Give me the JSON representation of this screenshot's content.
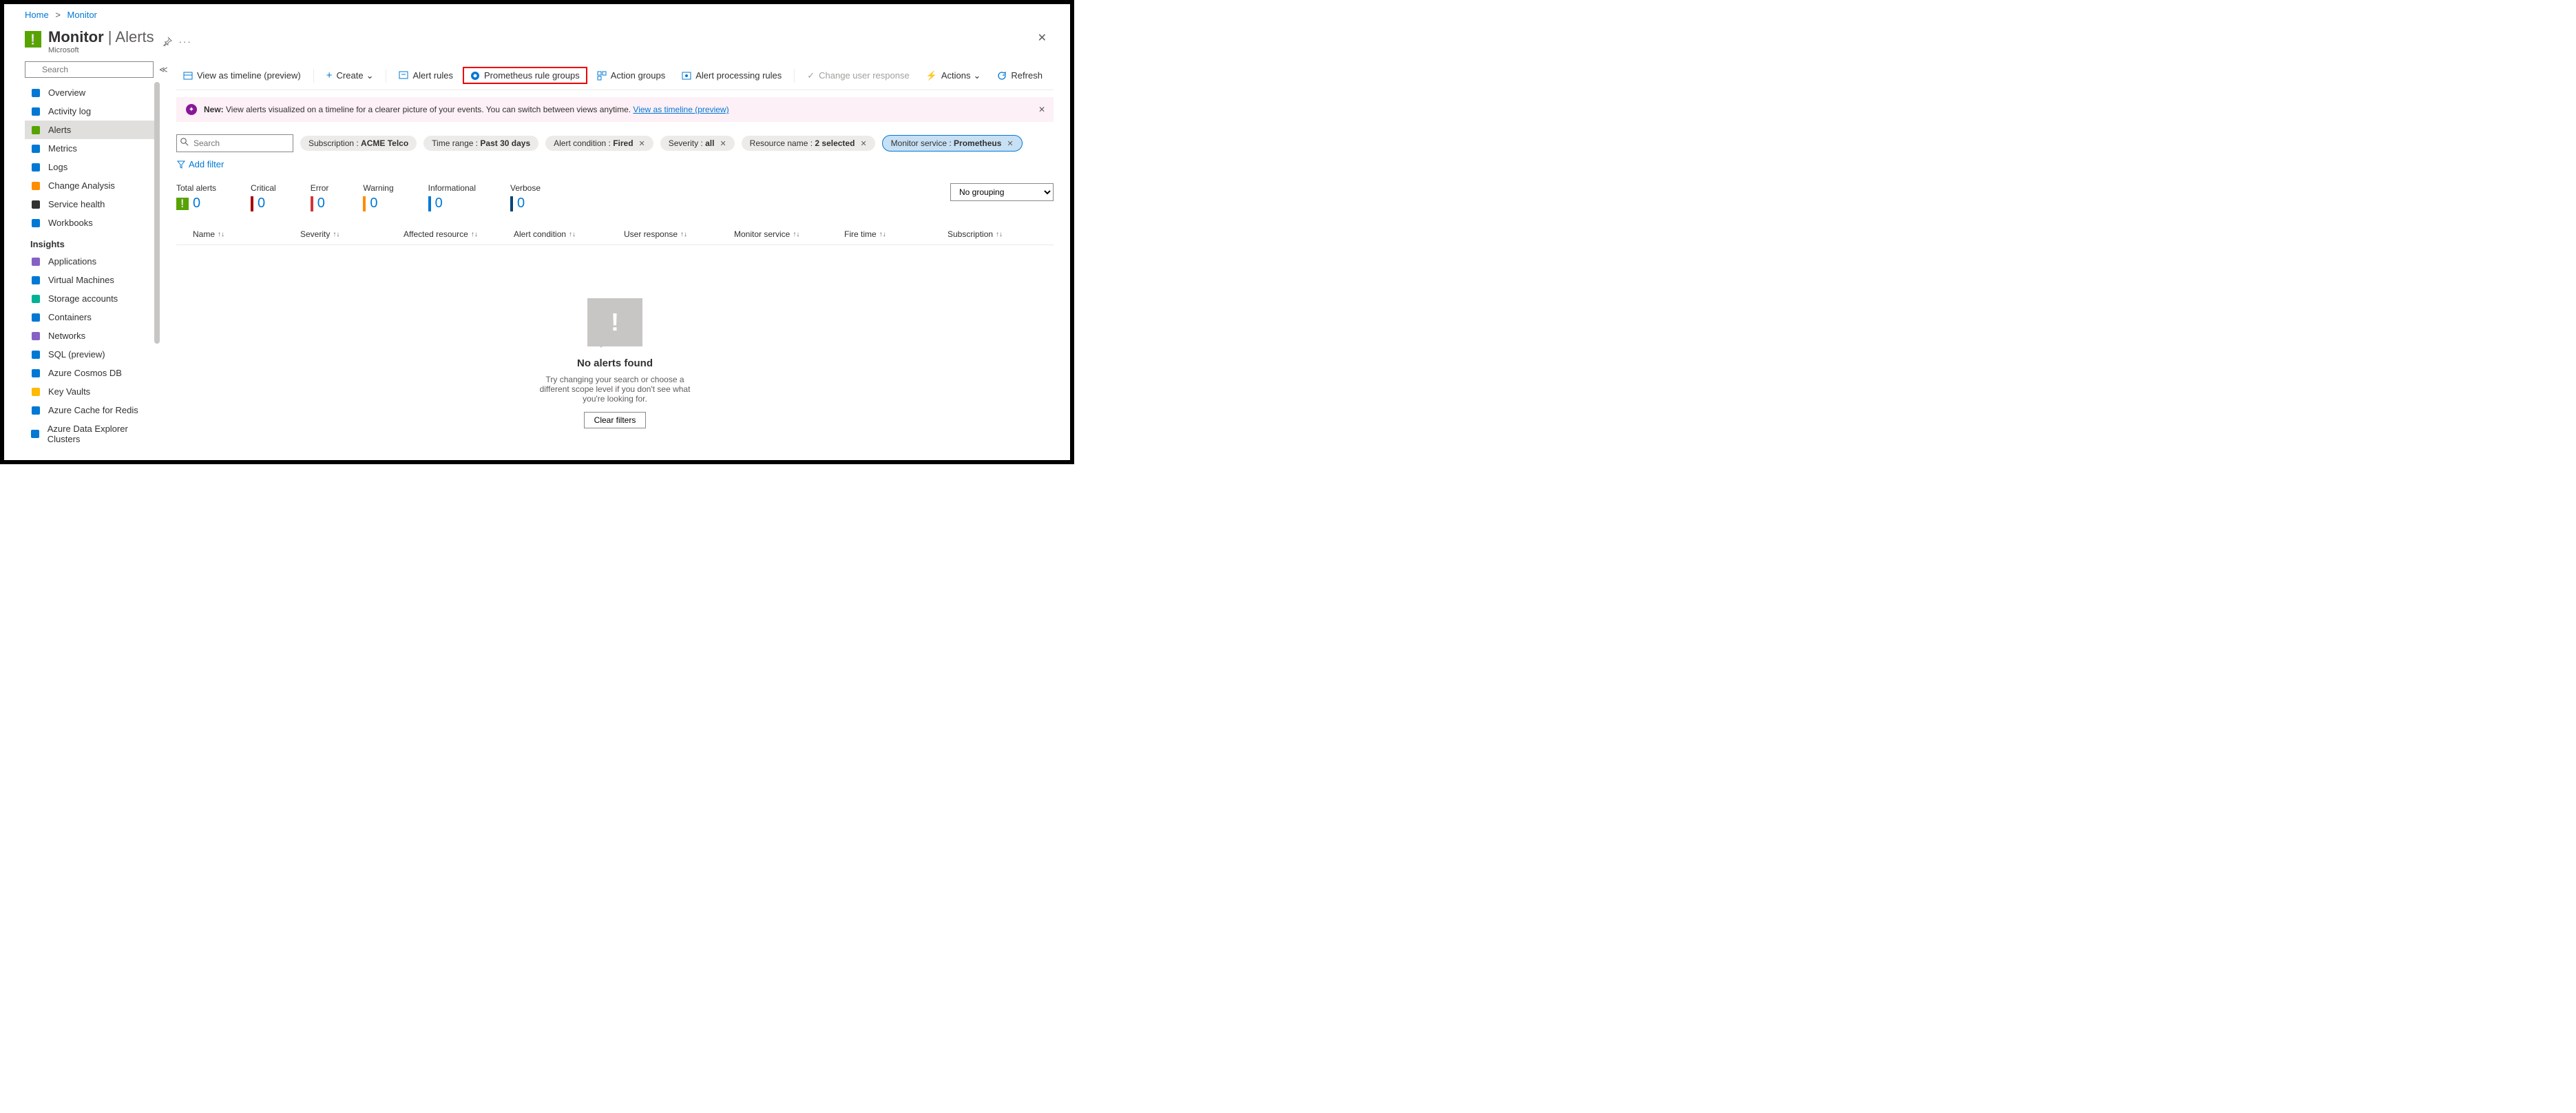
{
  "breadcrumb": {
    "home": "Home",
    "monitor": "Monitor"
  },
  "header": {
    "title_main": "Monitor",
    "title_sub": "Alerts",
    "vendor": "Microsoft"
  },
  "sidebar": {
    "search_placeholder": "Search",
    "items": [
      {
        "label": "Overview",
        "icon": "gauge",
        "color": "#0078d4"
      },
      {
        "label": "Activity log",
        "icon": "log",
        "color": "#0078d4"
      },
      {
        "label": "Alerts",
        "icon": "alert",
        "color": "#57a300",
        "active": true
      },
      {
        "label": "Metrics",
        "icon": "chart",
        "color": "#0078d4"
      },
      {
        "label": "Logs",
        "icon": "logs",
        "color": "#0078d4"
      },
      {
        "label": "Change Analysis",
        "icon": "change",
        "color": "#ff8c00"
      },
      {
        "label": "Service health",
        "icon": "heart",
        "color": "#323130"
      },
      {
        "label": "Workbooks",
        "icon": "book",
        "color": "#0078d4"
      }
    ],
    "section_insights": "Insights",
    "insights": [
      {
        "label": "Applications",
        "icon": "app",
        "color": "#8661c5"
      },
      {
        "label": "Virtual Machines",
        "icon": "vm",
        "color": "#0078d4"
      },
      {
        "label": "Storage accounts",
        "icon": "storage",
        "color": "#00b294"
      },
      {
        "label": "Containers",
        "icon": "container",
        "color": "#0078d4"
      },
      {
        "label": "Networks",
        "icon": "network",
        "color": "#8661c5"
      },
      {
        "label": "SQL (preview)",
        "icon": "sql",
        "color": "#0078d4"
      },
      {
        "label": "Azure Cosmos DB",
        "icon": "cosmos",
        "color": "#0078d4"
      },
      {
        "label": "Key Vaults",
        "icon": "key",
        "color": "#ffb900"
      },
      {
        "label": "Azure Cache for Redis",
        "icon": "redis",
        "color": "#0078d4"
      },
      {
        "label": "Azure Data Explorer Clusters",
        "icon": "adx",
        "color": "#0078d4"
      }
    ]
  },
  "toolbar": {
    "timeline": "View as timeline (preview)",
    "create": "Create",
    "alert_rules": "Alert rules",
    "prometheus": "Prometheus rule groups",
    "action_groups": "Action groups",
    "processing": "Alert processing rules",
    "change_user": "Change user response",
    "actions": "Actions",
    "refresh": "Refresh"
  },
  "banner": {
    "bold": "New:",
    "text": " View alerts visualized on a timeline for a clearer picture of your events. You can switch between views anytime. ",
    "link": "View as timeline (preview)"
  },
  "filters": {
    "search_placeholder": "Search",
    "chips": [
      {
        "label": "Subscription : ",
        "value": "ACME Telco",
        "x": false
      },
      {
        "label": "Time range : ",
        "value": "Past 30 days",
        "x": false
      },
      {
        "label": "Alert condition : ",
        "value": "Fired",
        "x": true
      },
      {
        "label": "Severity : ",
        "value": "all",
        "x": true
      },
      {
        "label": "Resource name : ",
        "value": "2 selected",
        "x": true
      },
      {
        "label": "Monitor service : ",
        "value": "Prometheus",
        "x": true,
        "selected": true
      }
    ],
    "add": "Add filter"
  },
  "stats": [
    {
      "label": "Total alerts",
      "value": "0",
      "color": "#57a300",
      "type": "icon"
    },
    {
      "label": "Critical",
      "value": "0",
      "color": "#a80000"
    },
    {
      "label": "Error",
      "value": "0",
      "color": "#d13438"
    },
    {
      "label": "Warning",
      "value": "0",
      "color": "#ff8c00"
    },
    {
      "label": "Informational",
      "value": "0",
      "color": "#0078d4"
    },
    {
      "label": "Verbose",
      "value": "0",
      "color": "#004578"
    }
  ],
  "grouping": {
    "selected": "No grouping"
  },
  "columns": [
    "Name",
    "Severity",
    "Affected resource",
    "Alert condition",
    "User response",
    "Monitor service",
    "Fire time",
    "Subscription"
  ],
  "empty": {
    "title": "No alerts found",
    "text": "Try changing your search or choose a different scope level if you don't see what you're looking for.",
    "button": "Clear filters"
  }
}
